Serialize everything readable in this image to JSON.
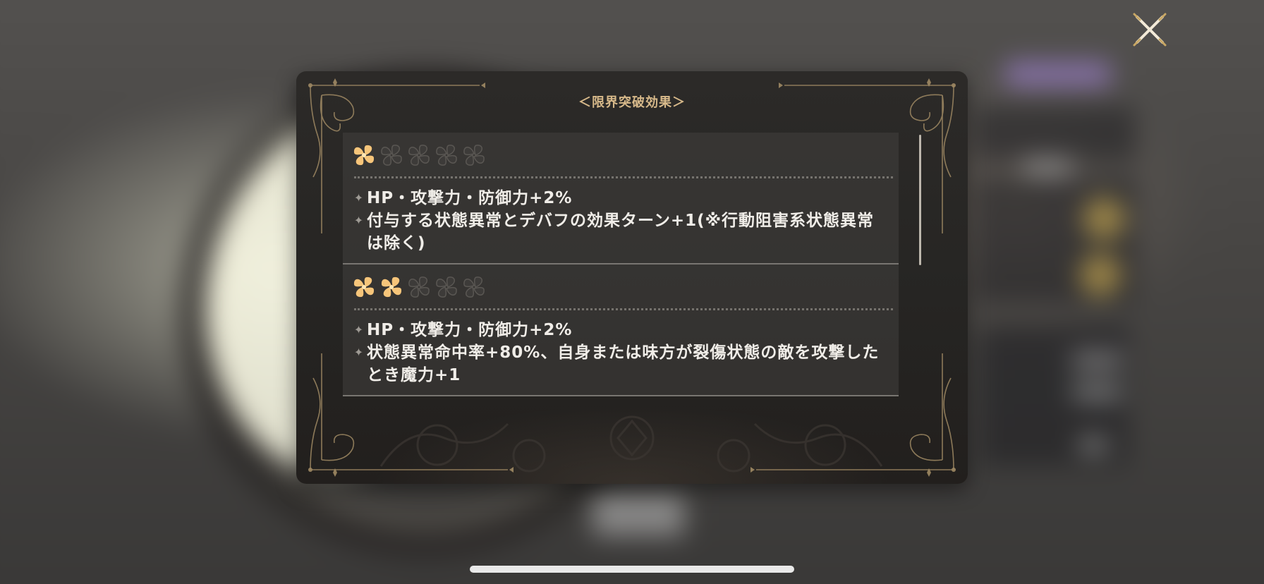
{
  "dialog": {
    "title": "＜限界突破効果＞",
    "sections": [
      {
        "stars": {
          "filled": 1,
          "total": 5
        },
        "effects": [
          "HP・攻撃力・防御力+2%",
          "付与する状態異常とデバフの効果ターン+1(※行動阻害系状態異常は除く)"
        ]
      },
      {
        "stars": {
          "filled": 2,
          "total": 5
        },
        "effects": [
          "HP・攻撃力・防御力+2%",
          "状態異常命中率+80%、自身または味方が裂傷状態の敵を攻撃したとき魔力+1"
        ]
      }
    ]
  },
  "icons": {
    "close": "close-icon",
    "star_filled": "star-filled-icon",
    "star_empty": "star-empty-icon",
    "bullet": "✦"
  },
  "colors": {
    "title": "#d7b98a",
    "star_filled": "#f6c57a",
    "star_empty": "#4a4845",
    "text": "#f0ede8",
    "ornament": "#a08a64"
  }
}
